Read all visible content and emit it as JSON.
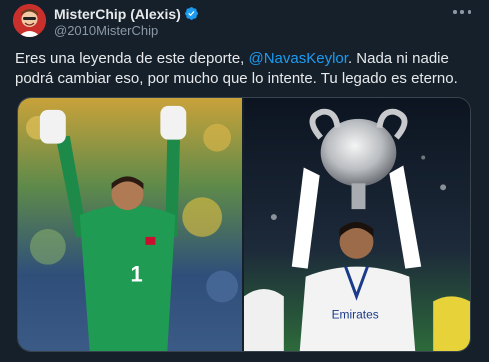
{
  "author": {
    "display_name": "MisterChip (Alexis)",
    "handle": "@2010MisterChip",
    "verified": true,
    "avatar_icon": "cartoon-avatar-icon"
  },
  "tweet": {
    "text_before": "Eres una leyenda de este deporte, ",
    "mention": "@NavasKeylor",
    "text_after": ". Nada ni nadie podrá cambiar eso, por mucho que lo intente. Tu legado es eterno."
  },
  "media": {
    "photos": [
      {
        "description_icon": "goalkeeper-celebrating-photo"
      },
      {
        "description_icon": "champions-trophy-photo"
      }
    ]
  },
  "colors": {
    "background": "#15202b",
    "text": "#e7e9ea",
    "secondary": "#8b98a5",
    "link": "#1d9bf0",
    "border": "#38444d"
  }
}
